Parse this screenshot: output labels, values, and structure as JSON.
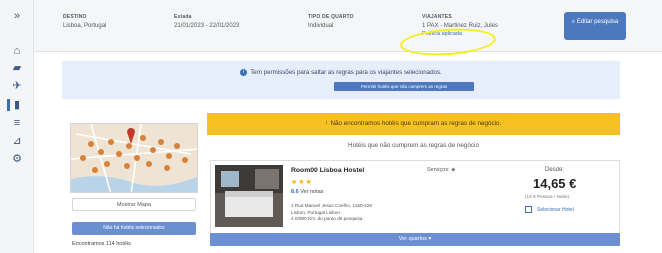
{
  "sidebar": {
    "items": [
      {
        "icon": "expand-icon",
        "glyph": "»"
      },
      {
        "icon": "home-icon",
        "glyph": "⌂"
      },
      {
        "icon": "car-icon",
        "glyph": "▰"
      },
      {
        "icon": "flight-icon",
        "glyph": "✈"
      },
      {
        "icon": "hotel-icon",
        "glyph": "▮"
      },
      {
        "icon": "list-icon",
        "glyph": "≡"
      },
      {
        "icon": "chart-icon",
        "glyph": "⊿"
      },
      {
        "icon": "settings-icon",
        "glyph": "⚙"
      }
    ]
  },
  "header": {
    "destino_label": "DESTINO",
    "destino_value": "Lisboa, Portugal",
    "estada_label": "Estada",
    "estada_value": "21/01/2023 - 22/01/2023",
    "tipo_label": "TIPO DE QUARTO",
    "tipo_value": "Individual",
    "viajantes_label": "VIAJANTES",
    "viajantes_value": "1 PAX - Martinez Ruiz, Jules",
    "viajantes_link": "Política aplicada",
    "edit_button": "Editar pesquisa",
    "edit_icon": "search-icon"
  },
  "info_banner": {
    "text": "Tem permissões para saltar as regras para os viajantes selecionados.",
    "button": "Permitir hotéis que não cumprem as regras"
  },
  "map_panel": {
    "show_map_button": "Mostrar Mapa",
    "no_selected_button": "Não há hotéis selecionados",
    "found_text": "Encontramos 114 hotéis"
  },
  "results": {
    "warning": "Não encontramos hotéis que cumpram as regras de negócio.",
    "subheading": "Hotéis que não cumprem as regras de negócio",
    "hotel": {
      "name": "Room00 Lisboa Hostel",
      "stars": "★★★",
      "reviews": "Ver notas",
      "rating": "8.6",
      "address_1": "1 Rua Manuel Jesus Coelho, 1150-228",
      "address_2": "Lisbon, Portugal Lisbon",
      "address_3": "4.0/990 Km. do ponto de pesquisa.",
      "services_label": "Serviços:",
      "from_label": "Desde:",
      "price": "14,65 €",
      "price_note": "(14 € Pessoa / Noite)",
      "select_label": "Selecionar Hotel",
      "rooms_button": "Ver quartos ▾"
    }
  },
  "colors": {
    "accent": "#4e78bd",
    "warning": "#f6c223",
    "highlight": "#f4ef1b",
    "info_bg": "#e6eefb"
  }
}
